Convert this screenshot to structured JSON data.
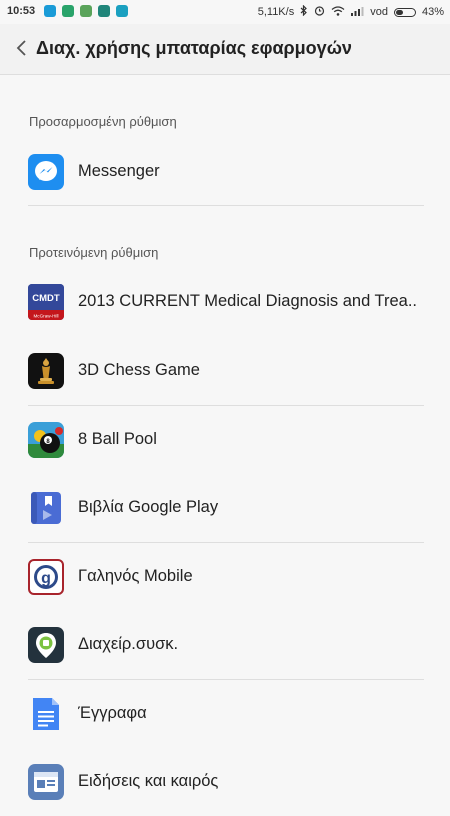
{
  "status_bar": {
    "time": "10:53",
    "net_speed": "5,11K/s",
    "carrier": "vod",
    "battery_percent": "43%",
    "battery_level": 0.43
  },
  "header": {
    "title": "Διαχ. χρήσης μπαταρίας εφαρμογών"
  },
  "sections": {
    "custom": {
      "title": "Προσαρμοσμένη ρύθμιση",
      "apps": [
        {
          "name": "Messenger",
          "icon": "messenger-icon"
        }
      ]
    },
    "recommended": {
      "title": "Προτεινόμενη ρύθμιση",
      "apps": [
        {
          "name": "2013 CURRENT Medical Diagnosis and Trea..",
          "icon": "cmdt-icon",
          "icon_text": "CMDT",
          "icon_subtext": "McGraw-Hill"
        },
        {
          "name": "3D Chess Game",
          "icon": "chess-icon"
        },
        {
          "name": "8 Ball Pool",
          "icon": "8-ball-pool-icon"
        },
        {
          "name": "Βιβλία Google Play",
          "icon": "google-play-books-icon"
        },
        {
          "name": "Γαληνός Mobile",
          "icon": "galinos-icon"
        },
        {
          "name": "Διαχείρ.συσκ.",
          "icon": "device-manager-icon"
        },
        {
          "name": "Έγγραφα",
          "icon": "google-docs-icon"
        },
        {
          "name": "Ειδήσεις και καιρός",
          "icon": "news-weather-icon"
        }
      ]
    }
  },
  "colors": {
    "messenger": "#1e8ef0",
    "docs": "#4285f4",
    "books": "#4a6cd4",
    "news": "#5a7fb8"
  }
}
